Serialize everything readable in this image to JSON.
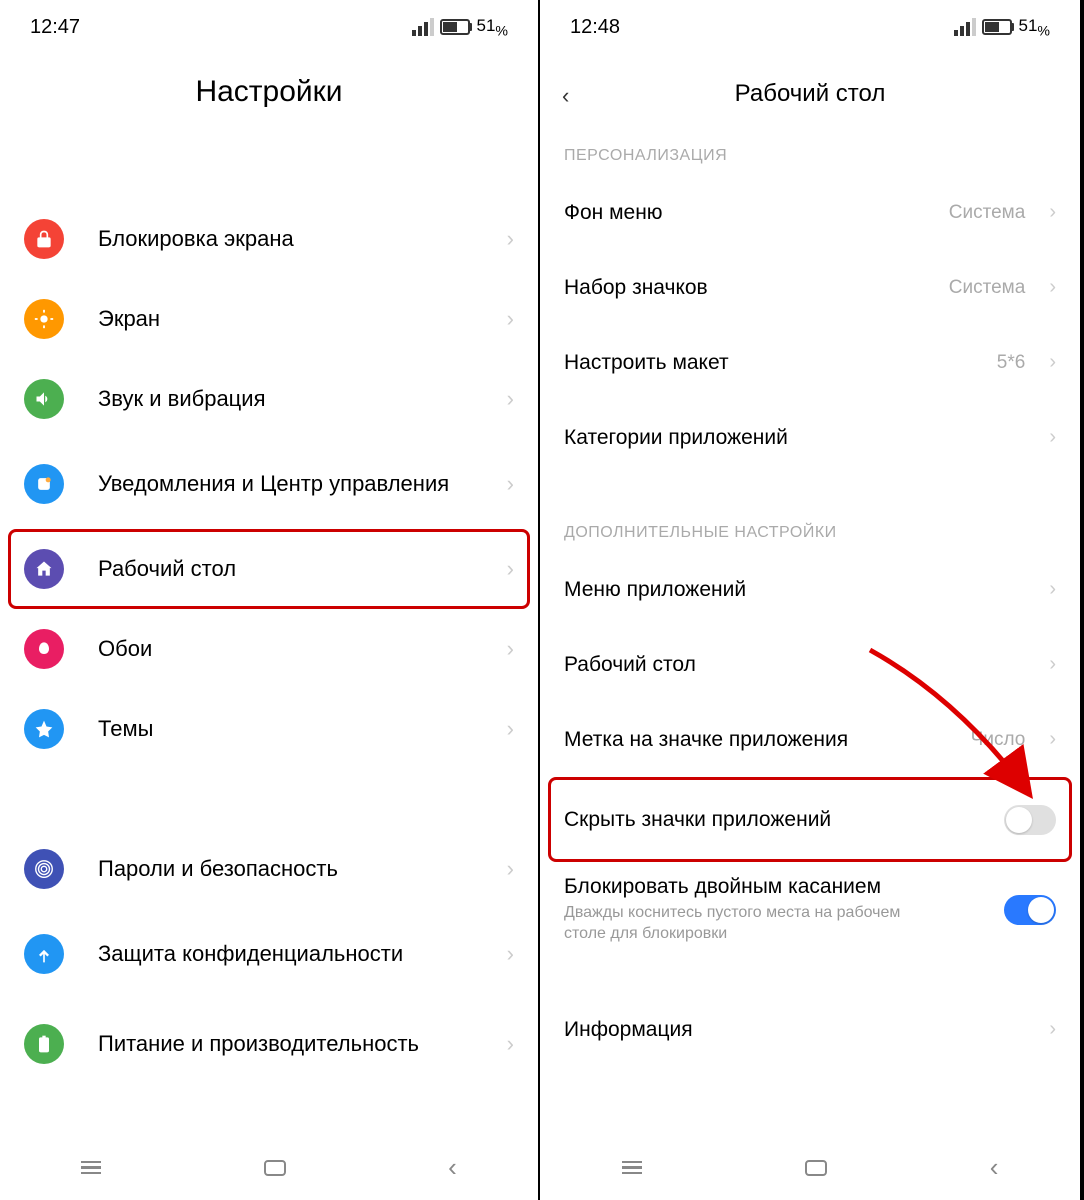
{
  "left": {
    "time": "12:47",
    "battery": "51",
    "battery_pct": "%",
    "title": "Настройки",
    "items": [
      {
        "label": "Блокировка экрана"
      },
      {
        "label": "Экран"
      },
      {
        "label": "Звук и вибрация"
      },
      {
        "label": "Уведомления и Центр управления"
      },
      {
        "label": "Рабочий стол"
      },
      {
        "label": "Обои"
      },
      {
        "label": "Темы"
      },
      {
        "label": "Пароли и безопасность"
      },
      {
        "label": "Защита конфиденциальности"
      },
      {
        "label": "Питание и производительность"
      }
    ]
  },
  "right": {
    "time": "12:48",
    "battery": "51",
    "battery_pct": "%",
    "title": "Рабочий стол",
    "section1": "ПЕРСОНАЛИЗАЦИЯ",
    "section2": "ДОПОЛНИТЕЛЬНЫЕ НАСТРОЙКИ",
    "rows": {
      "menu_bg": "Фон меню",
      "menu_bg_val": "Система",
      "icon_set": "Набор значков",
      "icon_set_val": "Система",
      "layout": "Настроить макет",
      "layout_val": "5*6",
      "categories": "Категории приложений",
      "app_menu": "Меню приложений",
      "desktop": "Рабочий стол",
      "badge": "Метка на значке приложения",
      "badge_val": "Число",
      "hide": "Скрыть значки приложений",
      "lock": "Блокировать двойным касанием",
      "lock_sub": "Дважды коснитесь пустого места на рабочем столе для блокировки",
      "info": "Информация"
    }
  }
}
